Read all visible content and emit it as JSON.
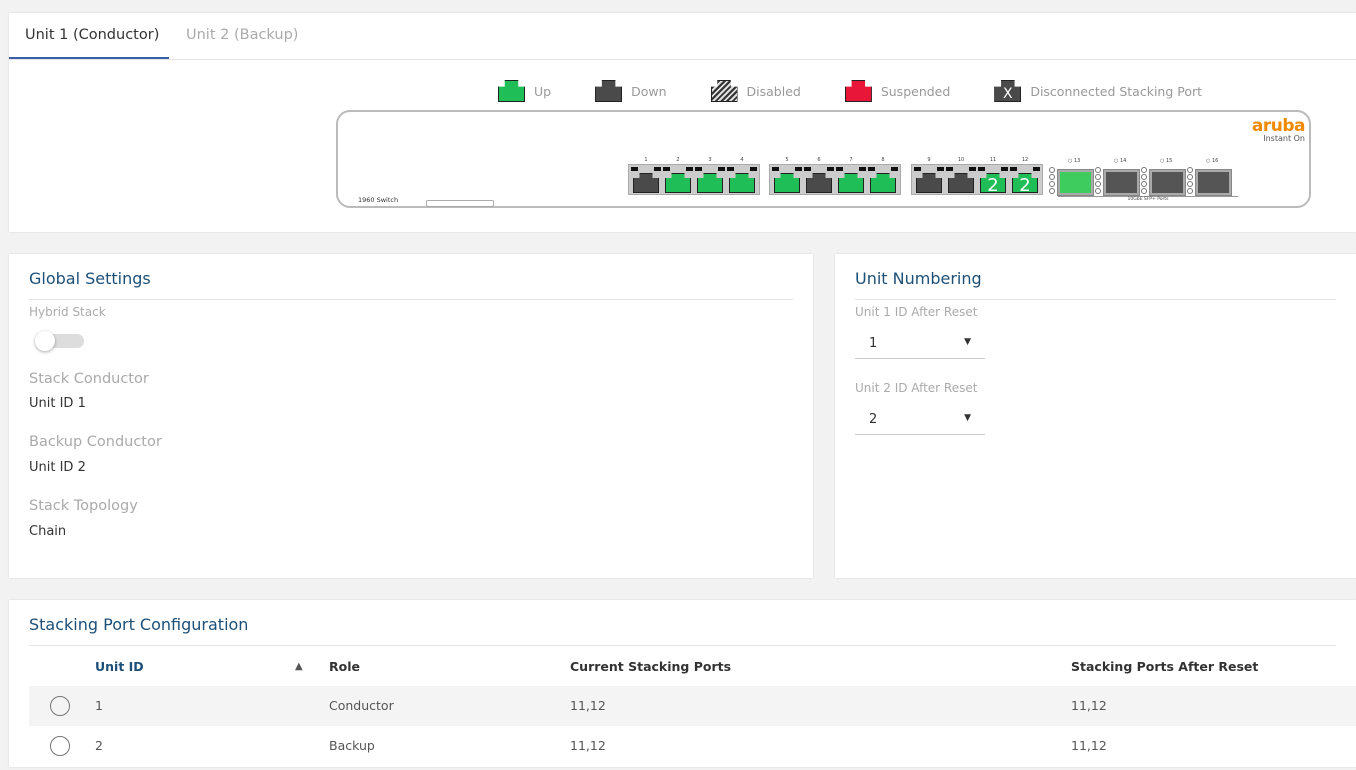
{
  "tabs": [
    {
      "label": "Unit 1 (Conductor)",
      "active": true
    },
    {
      "label": "Unit 2 (Backup)",
      "active": false
    }
  ],
  "legend": [
    {
      "label": "Up",
      "color": "#1fbe56"
    },
    {
      "label": "Down",
      "color": "#4a4a4a"
    },
    {
      "label": "Disabled",
      "color": "hatched"
    },
    {
      "label": "Suspended",
      "color": "#e8173a"
    },
    {
      "label": "Disconnected Stacking Port",
      "color": "#4a4a4a",
      "mark": "X"
    }
  ],
  "switch": {
    "model_label": "1960 Switch",
    "brand": "aruba",
    "brand_sub": "Instant On",
    "sfp_caption": "10GbE SFP+ Ports",
    "ports": [
      {
        "n": "1",
        "status": "down"
      },
      {
        "n": "2",
        "status": "up"
      },
      {
        "n": "3",
        "status": "up"
      },
      {
        "n": "4",
        "status": "up"
      },
      {
        "n": "5",
        "status": "up"
      },
      {
        "n": "6",
        "status": "down"
      },
      {
        "n": "7",
        "status": "up"
      },
      {
        "n": "8",
        "status": "up"
      },
      {
        "n": "9",
        "status": "down"
      },
      {
        "n": "10",
        "status": "down"
      },
      {
        "n": "11",
        "status": "up",
        "mark": "2"
      },
      {
        "n": "12",
        "status": "up",
        "mark": "2"
      }
    ],
    "sfp_ports": [
      {
        "n": "13",
        "status": "up"
      },
      {
        "n": "14",
        "status": "down"
      },
      {
        "n": "15",
        "status": "down"
      },
      {
        "n": "16",
        "status": "down"
      }
    ]
  },
  "global": {
    "title": "Global Settings",
    "hybrid_label": "Hybrid Stack",
    "hybrid_on": false,
    "conductor_label": "Stack Conductor",
    "conductor_value": "Unit ID 1",
    "backup_label": "Backup Conductor",
    "backup_value": "Unit ID 2",
    "topology_label": "Stack Topology",
    "topology_value": "Chain"
  },
  "numbering": {
    "title": "Unit Numbering",
    "unit1_label": "Unit 1 ID After Reset",
    "unit1_value": "1",
    "unit2_label": "Unit 2 ID After Reset",
    "unit2_value": "2"
  },
  "stacking": {
    "title": "Stacking Port Configuration",
    "headers": {
      "unit": "Unit ID",
      "sort": "▲",
      "role": "Role",
      "current": "Current Stacking Ports",
      "after": "Stacking Ports After Reset"
    },
    "rows": [
      {
        "unit": "1",
        "role": "Conductor",
        "current": "11,12",
        "after": "11,12"
      },
      {
        "unit": "2",
        "role": "Backup",
        "current": "11,12",
        "after": "11,12"
      }
    ]
  }
}
